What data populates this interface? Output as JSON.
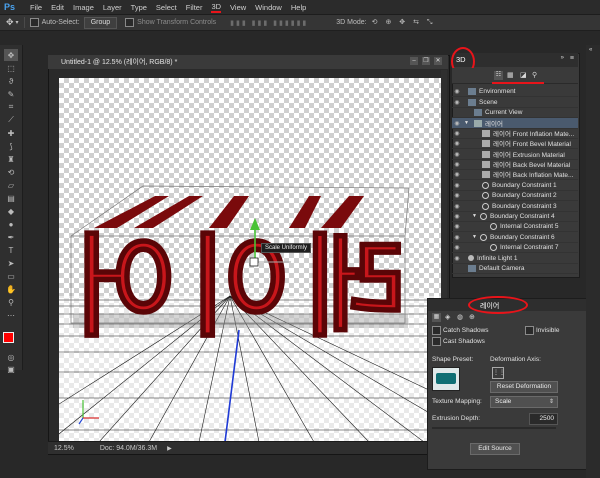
{
  "menu": {
    "logo": "Ps",
    "items": [
      "File",
      "Edit",
      "Image",
      "Layer",
      "Type",
      "Select",
      "Filter",
      "3D",
      "View",
      "Window",
      "Help"
    ]
  },
  "options": {
    "auto_select": "Auto-Select:",
    "group_value": "Group",
    "show_transform": "Show Transform Controls",
    "mode_label": "3D Mode:"
  },
  "document": {
    "tab_title": "Untitled-1 @ 12.5% (레이어, RGB/8) *",
    "zoom": "12.5%",
    "doc_info": "Doc: 94.0M/36.3M",
    "tooltip": "Scale Uniformly",
    "text_3d": "레이어"
  },
  "panel3d": {
    "title": "3D",
    "rows": [
      {
        "label": "Environment",
        "indent": 0,
        "expand": ""
      },
      {
        "label": "Scene",
        "indent": 0,
        "expand": ""
      },
      {
        "label": "Current View",
        "indent": 1,
        "expand": ""
      },
      {
        "label": "레이어",
        "indent": 1,
        "expand": "▼"
      },
      {
        "label": "레이어 Front Inflation Mate...",
        "indent": 2,
        "expand": ""
      },
      {
        "label": "레이어 Front Bevel Material",
        "indent": 2,
        "expand": ""
      },
      {
        "label": "레이어 Extrusion Material",
        "indent": 2,
        "expand": ""
      },
      {
        "label": "레이어 Back Bevel Material",
        "indent": 2,
        "expand": ""
      },
      {
        "label": "레이어 Back Inflation Mate...",
        "indent": 2,
        "expand": ""
      },
      {
        "label": "Boundary Constraint 1",
        "indent": 2,
        "expand": ""
      },
      {
        "label": "Boundary Constraint 2",
        "indent": 2,
        "expand": ""
      },
      {
        "label": "Boundary Constraint 3",
        "indent": 2,
        "expand": ""
      },
      {
        "label": "Boundary Constraint 4",
        "indent": 2,
        "expand": "▼"
      },
      {
        "label": "Internal Constraint 5",
        "indent": 3,
        "expand": ""
      },
      {
        "label": "Boundary Constraint 6",
        "indent": 2,
        "expand": "▼"
      },
      {
        "label": "Internal Constraint 7",
        "indent": 3,
        "expand": ""
      },
      {
        "label": "Infinite Light 1",
        "indent": 0,
        "expand": ""
      },
      {
        "label": "Default Camera",
        "indent": 0,
        "expand": ""
      }
    ]
  },
  "properties": {
    "title": "레이어",
    "catch_shadows": "Catch Shadows",
    "invisible": "Invisible",
    "cast_shadows": "Cast Shadows",
    "shape_preset": "Shape Preset:",
    "deformation_axis": "Deformation Axis:",
    "reset_deformation": "Reset Deformation",
    "texture_mapping": "Texture Mapping:",
    "texture_value": "Scale",
    "extrusion_depth": "Extrusion Depth:",
    "extrusion_value": "2500",
    "edit_source": "Edit Source"
  },
  "colors": {
    "accent": "#e8141a",
    "text3d": "#c8161b",
    "foreground": "#ff0000"
  }
}
